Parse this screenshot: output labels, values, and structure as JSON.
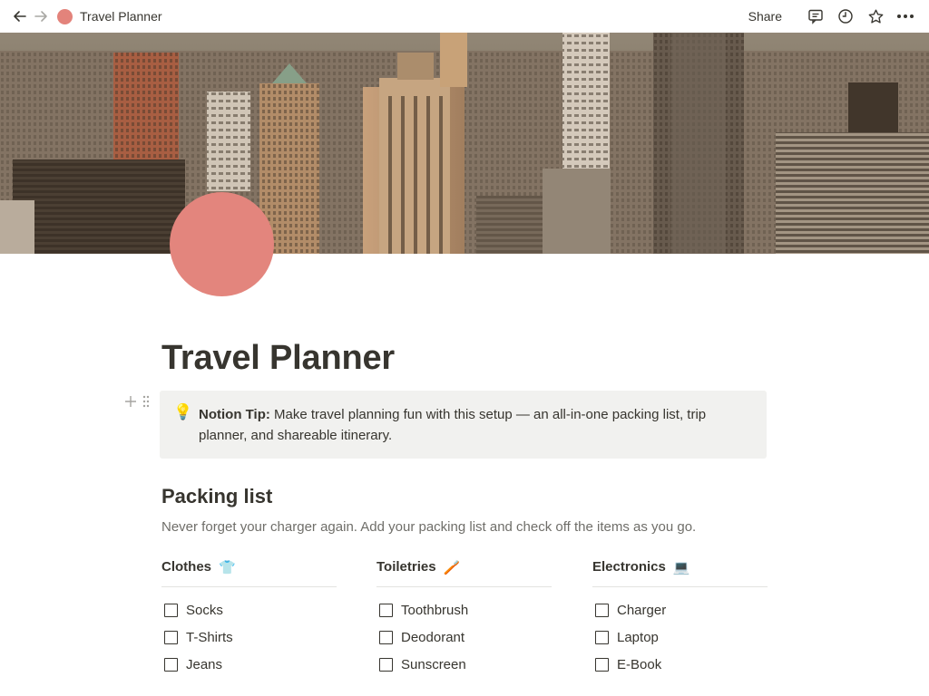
{
  "topbar": {
    "breadcrumb": "Travel Planner",
    "share_label": "Share",
    "icons": [
      "arrow-left-icon",
      "arrow-right-icon",
      "comment-icon",
      "history-icon",
      "star-icon",
      "more-icon"
    ]
  },
  "page": {
    "title": "Travel Planner",
    "icon_color": "#e3857d",
    "callout": {
      "emoji": "💡",
      "bold": "Notion Tip:",
      "text": " Make travel planning fun with this setup — an all-in-one packing list, trip planner, and shareable itinerary."
    },
    "packing": {
      "heading": "Packing list",
      "description": "Never forget your charger again. Add your packing list and check off the items as you go.",
      "columns": [
        {
          "title": "Clothes",
          "emoji": "👕",
          "items": [
            "Socks",
            "T-Shirts",
            "Jeans"
          ]
        },
        {
          "title": "Toiletries",
          "emoji": "🪥",
          "items": [
            "Toothbrush",
            "Deodorant",
            "Sunscreen"
          ]
        },
        {
          "title": "Electronics",
          "emoji": "💻",
          "items": [
            "Charger",
            "Laptop",
            "E-Book"
          ]
        }
      ]
    }
  },
  "colors": {
    "text": "#37352f",
    "muted": "#6f6e69",
    "callout_bg": "#f1f1ef"
  }
}
